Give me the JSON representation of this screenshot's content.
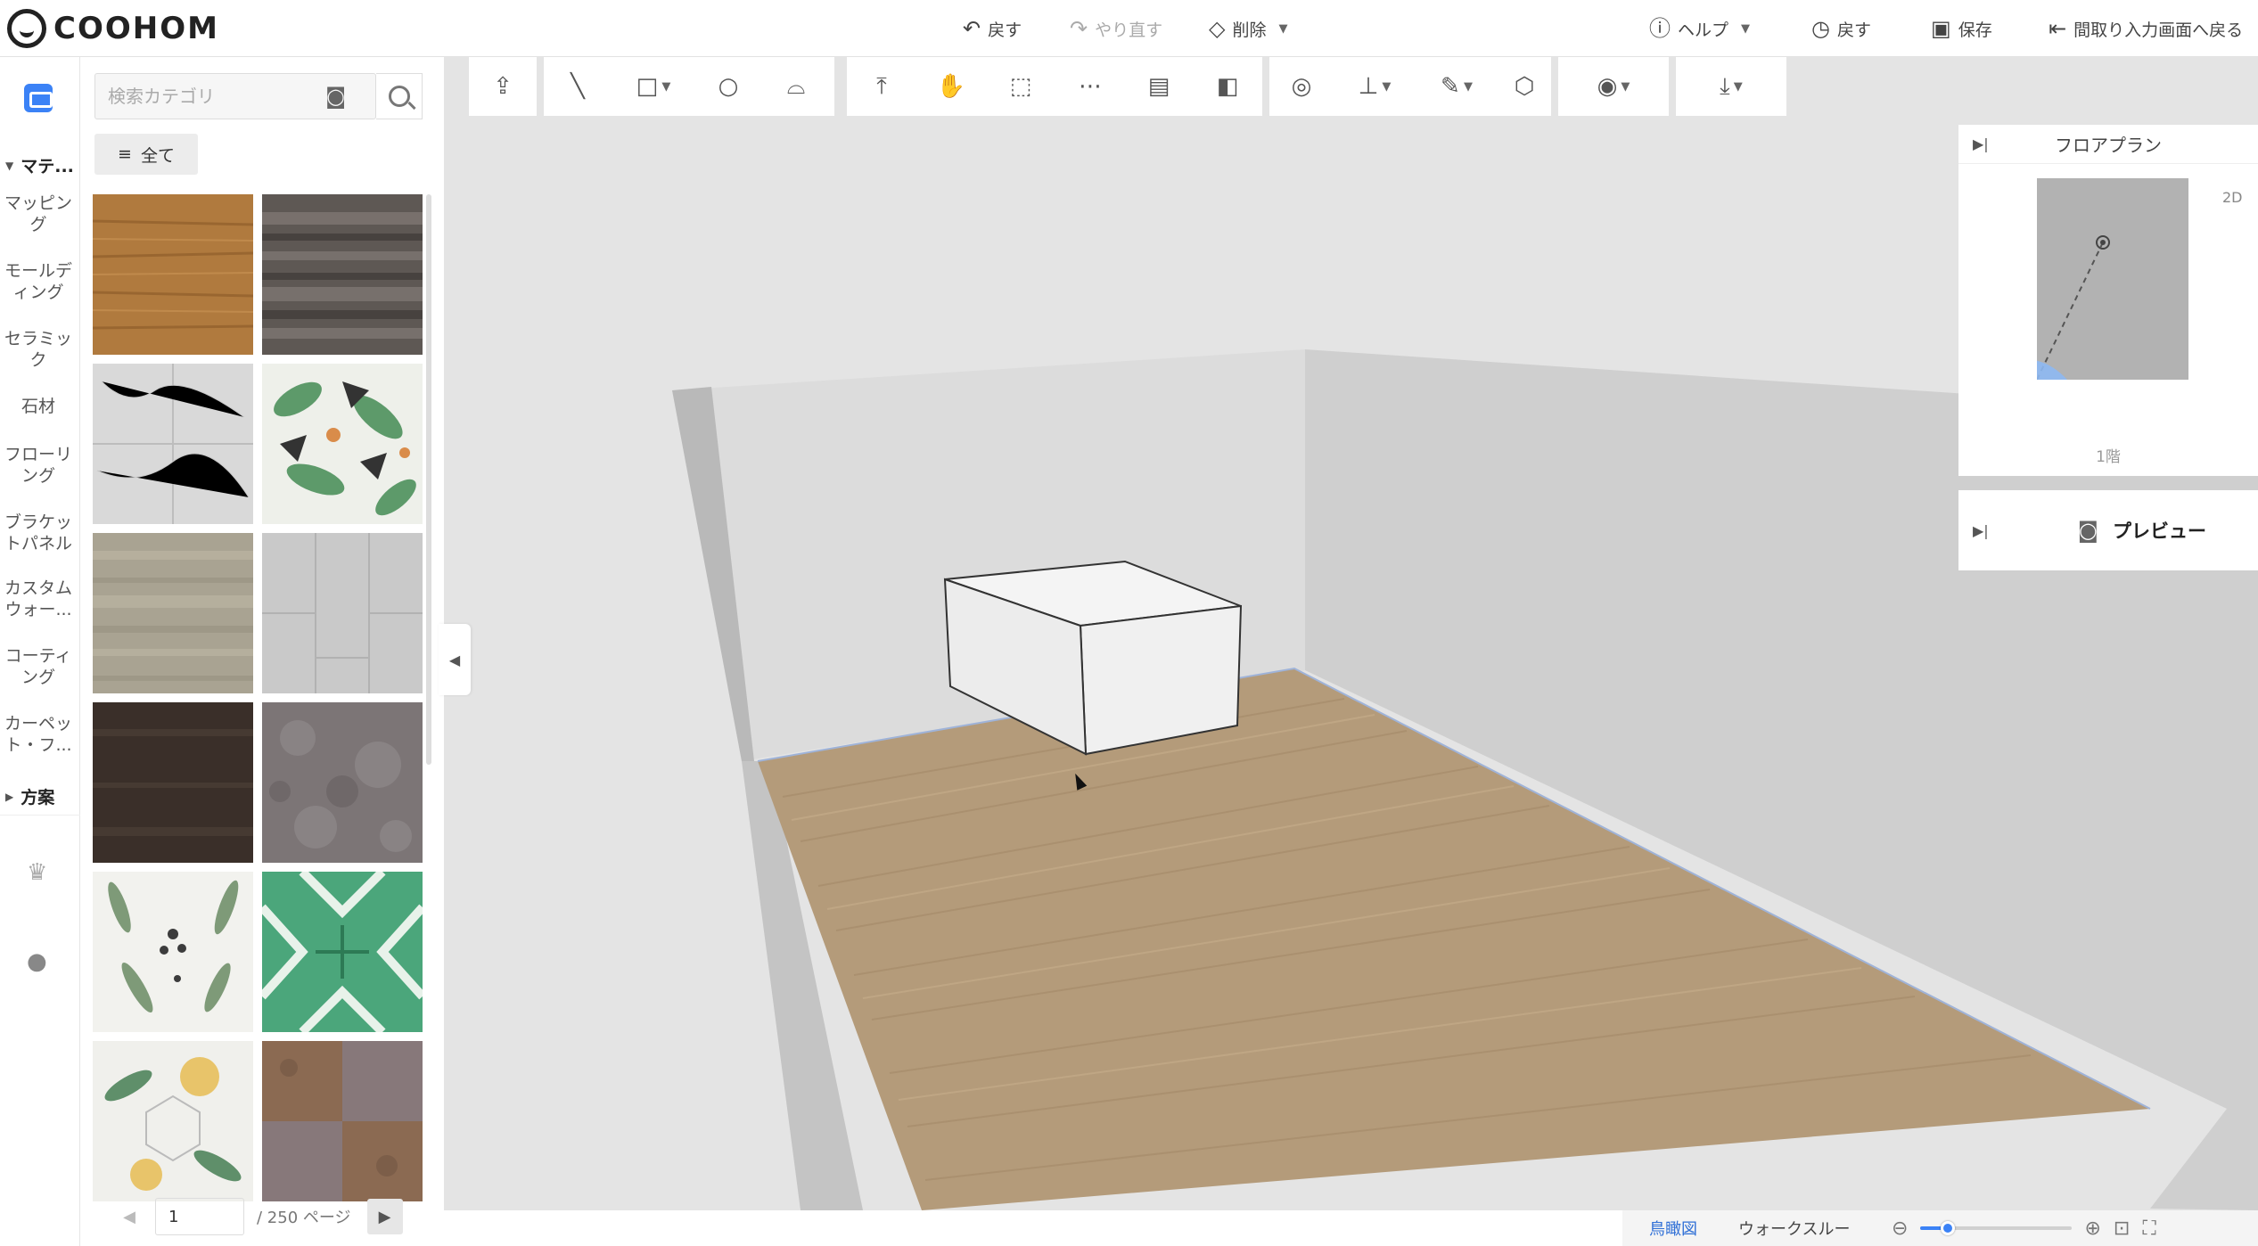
{
  "app": {
    "logo_text": "COOHOM",
    "colors": {
      "accent": "#3b82f6",
      "floor": "#b49b7a",
      "wall": "#d7d7d7"
    }
  },
  "topbar": {
    "undo": "戻す",
    "redo": "やり直す",
    "delete": "削除",
    "help": "ヘルプ",
    "history": "戻す",
    "save": "保存",
    "back_to_floorplan": "間取り入力画面へ戻る"
  },
  "rail": {
    "section_materials": "マテ...",
    "items": [
      "マッピング",
      "モールディング",
      "セラミック",
      "石材",
      "フローリング",
      "ブラケットパネル",
      "カスタムウォー...",
      "コーティング",
      "カーペット・フ..."
    ],
    "section_plans": "方案"
  },
  "panel": {
    "search_placeholder": "検索カテゴリ",
    "filter_label": "全て",
    "tiles": [
      "wood-orange",
      "stone-dark-grey",
      "marble-white",
      "tropical-leaves",
      "concrete-beige",
      "grey-tile",
      "dark-brown",
      "granite-grey",
      "leaf-pattern-white",
      "green-geometric",
      "floral-hexagon",
      "checker-brown"
    ],
    "pager": {
      "page": "1",
      "total": "/ 250 ページ"
    }
  },
  "floorplan": {
    "title": "フロアプラン",
    "mode": "2D",
    "level": "1階"
  },
  "preview": {
    "label": "プレビュー"
  },
  "bottombar": {
    "mode_birdseye": "鳥瞰図",
    "mode_walkthrough": "ウォークスルー",
    "zoom_fraction": 0.18
  }
}
